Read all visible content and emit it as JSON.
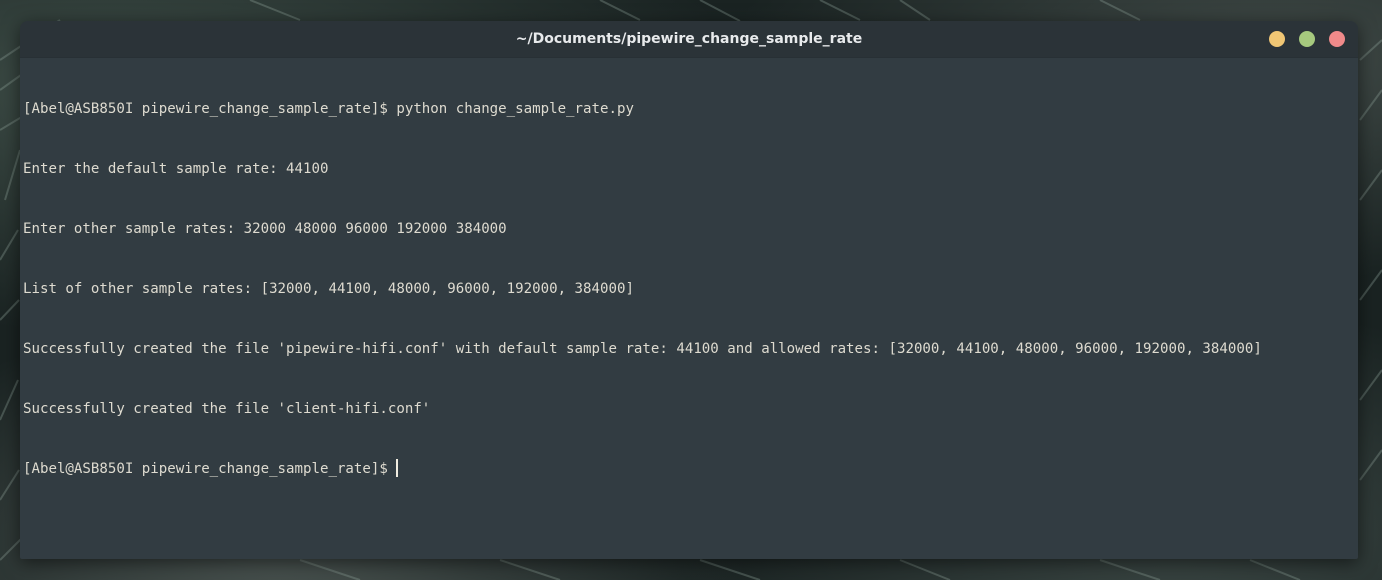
{
  "window": {
    "title": "~/Documents/pipewire_change_sample_rate",
    "controls": [
      {
        "name": "minimize",
        "color": "#f0c674"
      },
      {
        "name": "maximize",
        "color": "#a6c97e"
      },
      {
        "name": "close",
        "color": "#f08a8a"
      }
    ]
  },
  "terminal": {
    "lines": [
      "[Abel@ASB850I pipewire_change_sample_rate]$ python change_sample_rate.py",
      "Enter the default sample rate: 44100",
      "Enter other sample rates: 32000 48000 96000 192000 384000",
      "List of other sample rates: [32000, 44100, 48000, 96000, 192000, 384000]",
      "Successfully created the file 'pipewire-hifi.conf' with default sample rate: 44100 and allowed rates: [32000, 44100, 48000, 96000, 192000, 384000]",
      "Successfully created the file 'client-hifi.conf'"
    ],
    "prompt": "[Abel@ASB850I pipewire_change_sample_rate]$ "
  }
}
